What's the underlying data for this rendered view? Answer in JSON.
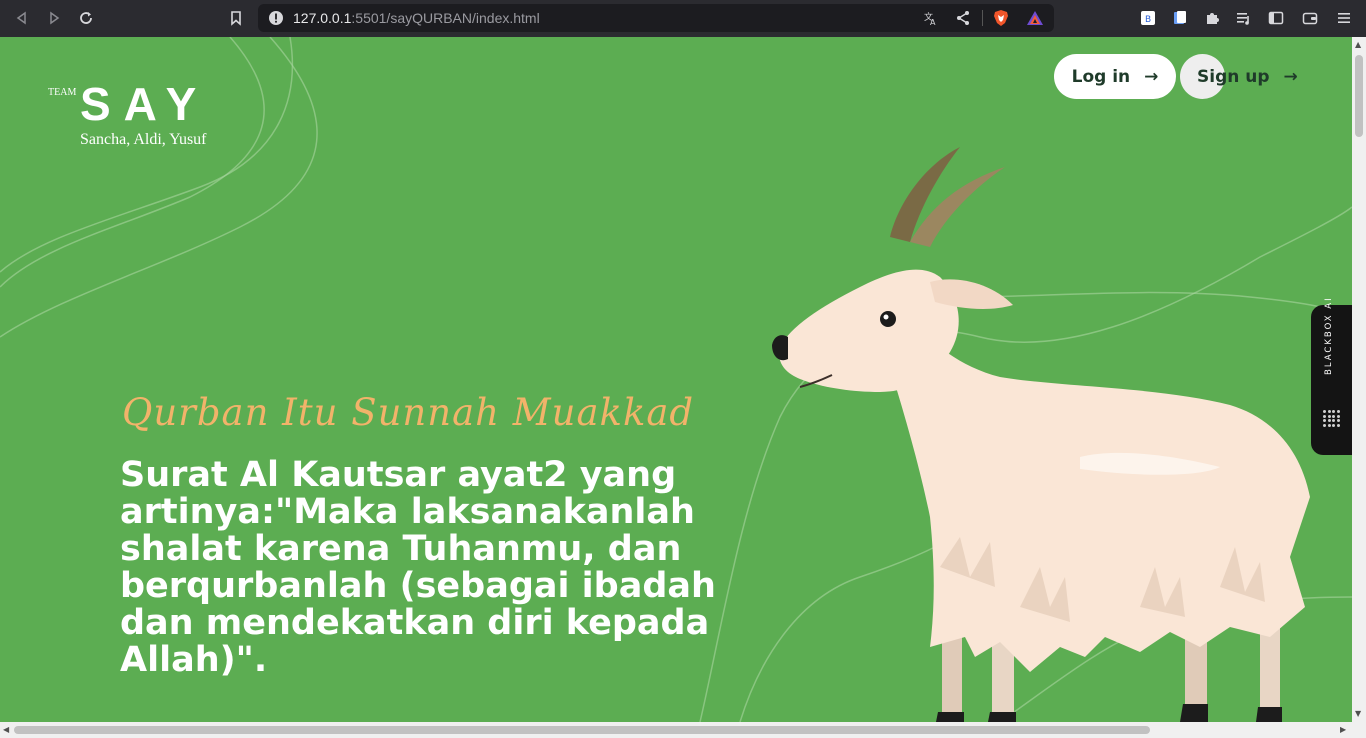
{
  "browser": {
    "url_host": "127.0.0.1",
    "url_rest": ":5501/sayQURBAN/index.html",
    "back_icon": "back-icon",
    "forward_icon": "forward-icon",
    "reload_icon": "reload-icon"
  },
  "logo": {
    "team_label": "TEAM",
    "name": "SAY",
    "members": "Sancha, Aldi, Yusuf"
  },
  "nav": {
    "login_label": "Log in",
    "signup_label": "Sign up",
    "arrow": "→"
  },
  "hero": {
    "subtitle": "Qurban Itu Sunnah Muakkad",
    "headline": "Surat Al Kautsar ayat2 yang artinya:\"Maka laksanakanlah shalat karena Tuhanmu, dan berqurbanlah (sebagai ibadah dan mendekatkan diri kepada Allah)\"."
  },
  "extension_tab": {
    "label": "BLACKBOX AI"
  },
  "colors": {
    "page_background": "#5cad52",
    "subtitle": "#f2b36a",
    "goat_body": "#fae6d6",
    "horn": "#8c7a52"
  }
}
